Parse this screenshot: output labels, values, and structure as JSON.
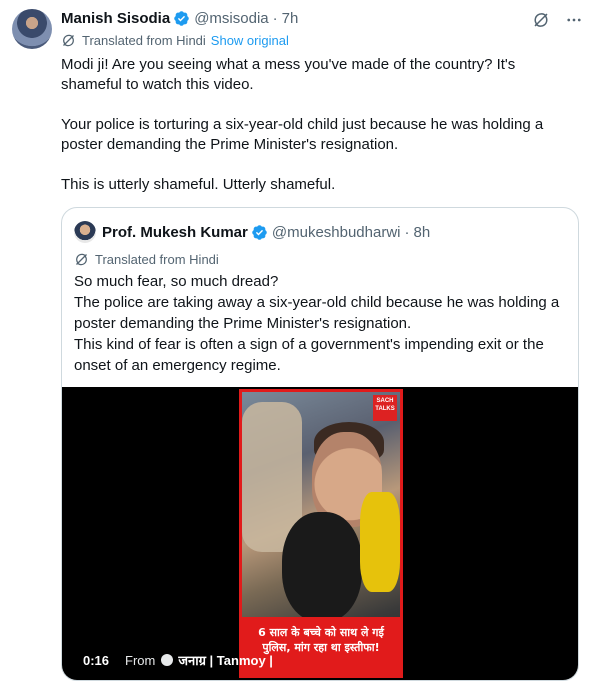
{
  "tweet": {
    "author_name": "Manish Sisodia",
    "handle": "@msisodia",
    "separator": "·",
    "time": "7h",
    "translated_label": "Translated from Hindi",
    "show_original": "Show original",
    "paragraphs": [
      "Modi ji! Are you seeing what a mess you've made of the country? It's shameful to watch this video.",
      "Your police is torturing a six-year-old child just because he was holding a poster demanding the Prime Minister's resignation.",
      "This is utterly shameful. Utterly shameful."
    ]
  },
  "quote": {
    "author_name": "Prof. Mukesh Kumar",
    "handle": "@mukeshbudharwi",
    "separator": "·",
    "time": "8h",
    "translated_label": "Translated from Hindi",
    "lines": [
      "So much fear, so much dread?",
      "The police are taking away a six-year-old child because he was holding a poster demanding the Prime Minister's resignation.",
      "This kind of fear is often a sign of a government's impending exit or the onset of an emergency regime."
    ],
    "video": {
      "duration": "0:16",
      "from_label": "From",
      "source": "जनाग्र | Tanmoy |",
      "thumb_logo": "SACH TALKS",
      "thumb_caption_line1": "6 साल के बच्चे को साथ ले गई",
      "thumb_caption_line2": "पुलिस, मांग रहा था इस्तीफा!"
    }
  },
  "icons": {
    "verified": "verified-badge-icon",
    "grok": "grok-icon",
    "more": "more-options-icon",
    "translate": "translate-icon"
  },
  "colors": {
    "accent": "#1d9bf0",
    "secondary_text": "#536471",
    "thumb_border": "#e11b1b"
  }
}
